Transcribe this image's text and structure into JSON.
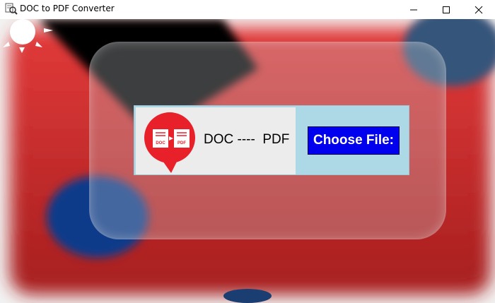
{
  "window": {
    "title": "DOC to PDF Converter",
    "controls": {
      "minimize": "minimize-icon",
      "maximize": "maximize-icon",
      "close": "close-icon"
    }
  },
  "main": {
    "label": "DOC ----  PDF",
    "choose_button": "Choose File:",
    "logo": {
      "left_doc": "DOC",
      "right_doc": "PDF"
    }
  },
  "colors": {
    "background_red": "#d43a3a",
    "panel": "#add8e6",
    "button": "#0000ee",
    "logo_red": "#e8202a"
  }
}
